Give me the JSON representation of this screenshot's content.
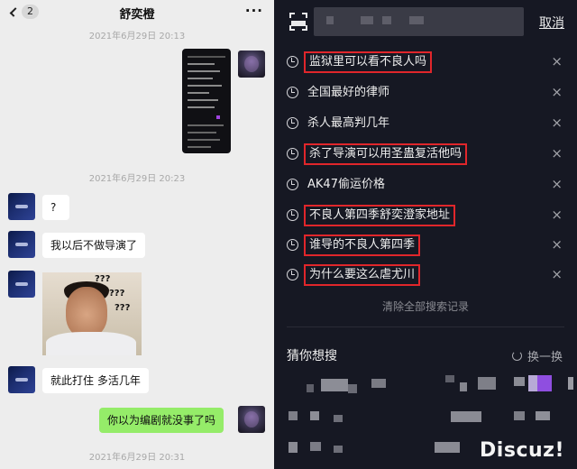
{
  "chat": {
    "header": {
      "back_badge": "2",
      "title": "舒奕橙",
      "more": "···"
    },
    "timestamps": [
      "2021年6月29日 20:13",
      "2021年6月29日 20:23",
      "2021年6月29日 20:31"
    ],
    "messages": [
      {
        "from": "other",
        "text": "?"
      },
      {
        "from": "other",
        "text": "我以后不做导演了"
      },
      {
        "from": "other",
        "type": "image",
        "image_text": [
          "???",
          "???",
          "???"
        ]
      },
      {
        "from": "other",
        "text": "就此打住 多活几年"
      },
      {
        "from": "self",
        "text": "你以为编剧就没事了吗"
      }
    ]
  },
  "search": {
    "cancel_label": "取消",
    "history": [
      {
        "text": "监狱里可以看不良人吗",
        "highlighted": true
      },
      {
        "text": "全国最好的律师",
        "highlighted": false
      },
      {
        "text": "杀人最高判几年",
        "highlighted": false
      },
      {
        "text": "杀了导演可以用圣蛊复活他吗",
        "highlighted": true
      },
      {
        "text": "AK47偷运价格",
        "highlighted": false
      },
      {
        "text": "不良人第四季舒奕澄家地址",
        "highlighted": true
      },
      {
        "text": "谁导的不良人第四季",
        "highlighted": true
      },
      {
        "text": "为什么要这么虐尤川",
        "highlighted": true
      }
    ],
    "delete_glyph": "×",
    "clear_all": "清除全部搜索记录",
    "guess_title": "猜你想搜",
    "refresh_label": "换一换",
    "highlight_color": "#e0262b"
  },
  "watermark": "Discuz!"
}
